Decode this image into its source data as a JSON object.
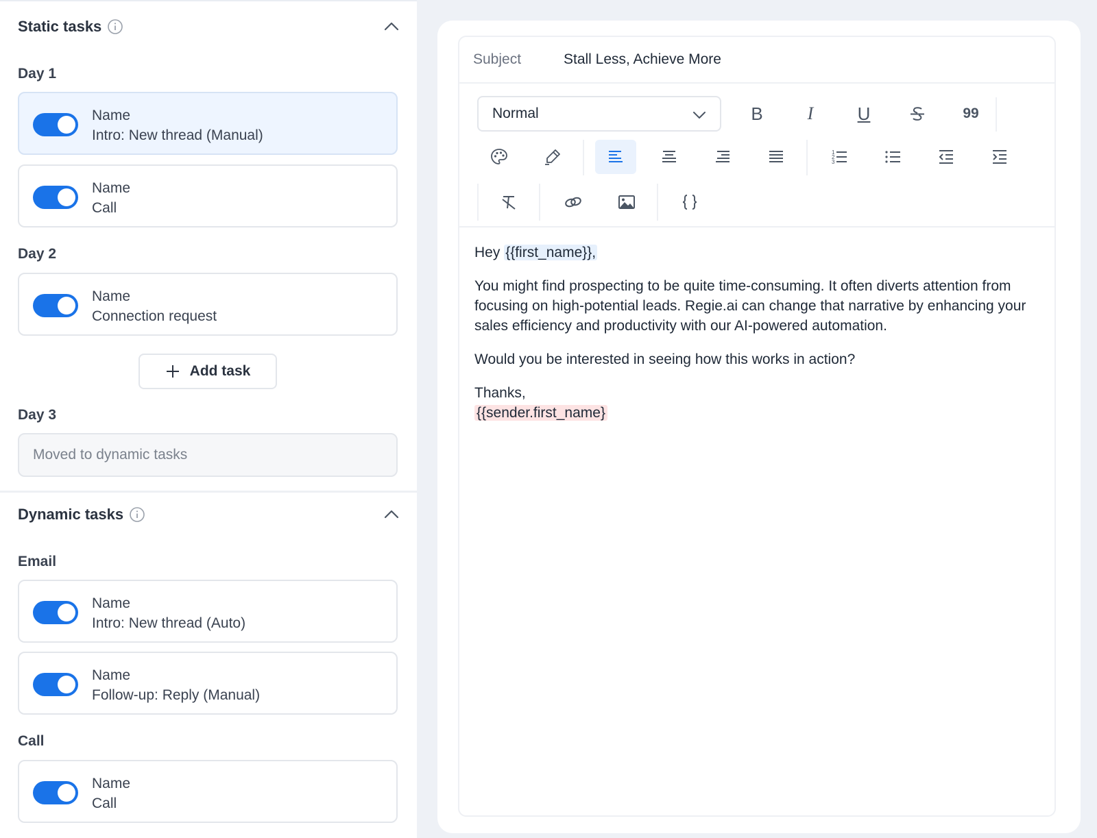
{
  "static_tasks": {
    "title": "Static tasks",
    "days": [
      {
        "label": "Day 1",
        "tasks": [
          {
            "name": "Name",
            "value": "Intro: New thread (Manual)",
            "enabled": true,
            "selected": true
          },
          {
            "name": "Name",
            "value": "Call",
            "enabled": true,
            "selected": false
          }
        ]
      },
      {
        "label": "Day 2",
        "tasks": [
          {
            "name": "Name",
            "value": "Connection request",
            "enabled": true,
            "selected": false
          }
        ]
      },
      {
        "label": "Day 3",
        "moved_text": "Moved to dynamic tasks"
      }
    ],
    "add_task_label": "Add task"
  },
  "dynamic_tasks": {
    "title": "Dynamic tasks",
    "groups": [
      {
        "label": "Email",
        "tasks": [
          {
            "name": "Name",
            "value": "Intro: New thread (Auto)",
            "enabled": true
          },
          {
            "name": "Name",
            "value": "Follow-up: Reply (Manual)",
            "enabled": true
          }
        ]
      },
      {
        "label": "Call",
        "tasks": [
          {
            "name": "Name",
            "value": "Call",
            "enabled": true
          }
        ]
      }
    ]
  },
  "editor": {
    "subject_label": "Subject",
    "subject_value": "Stall Less, Achieve More",
    "text_style": "Normal",
    "toolbar_quote_label": "99",
    "toolbar_bold_label": "B",
    "toolbar_italic_label": "I",
    "toolbar_underline_label": "U",
    "active_alignment": "left",
    "body": {
      "greeting_prefix": "Hey ",
      "greeting_variable": "{{first_name}},",
      "paragraph_1": "You might find prospecting to be quite time-consuming. It often diverts attention from focusing on high-potential leads. Regie.ai can change that narrative by enhancing your sales efficiency and productivity with our AI-powered automation.",
      "paragraph_2": "Would you be interested in seeing how this works in action?",
      "signoff": "Thanks,",
      "sender_variable": "{{sender.first_name}"
    }
  },
  "colors": {
    "toggle_on": "#1a73e8",
    "selected_card_bg": "#eef5ff",
    "variable_highlight_blue": "#e6f0fc",
    "variable_highlight_red": "#fde3e3"
  }
}
